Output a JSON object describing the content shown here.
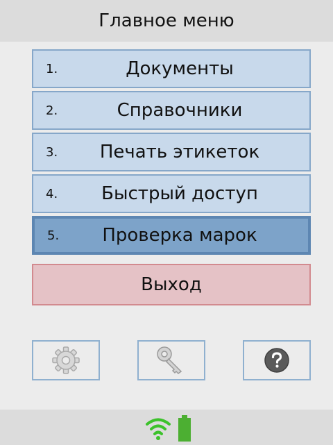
{
  "header": {
    "title": "Главное меню"
  },
  "menu": {
    "items": [
      {
        "number": "1.",
        "label": "Документы"
      },
      {
        "number": "2.",
        "label": "Справочники"
      },
      {
        "number": "3.",
        "label": "Печать этикеток"
      },
      {
        "number": "4.",
        "label": "Быстрый доступ"
      },
      {
        "number": "5.",
        "label": "Проверка марок",
        "selected": true
      }
    ],
    "exit_label": "Выход"
  },
  "toolbar": {
    "icons": [
      "gear-icon",
      "key-icon",
      "help-icon"
    ]
  },
  "status": {
    "icons": [
      "wifi-icon",
      "battery-icon"
    ]
  },
  "colors": {
    "button_bg": "#c8d9eb",
    "selected_bg": "#7da3c9",
    "exit_bg": "#e5c2c6",
    "status_green": "#4caf32"
  }
}
